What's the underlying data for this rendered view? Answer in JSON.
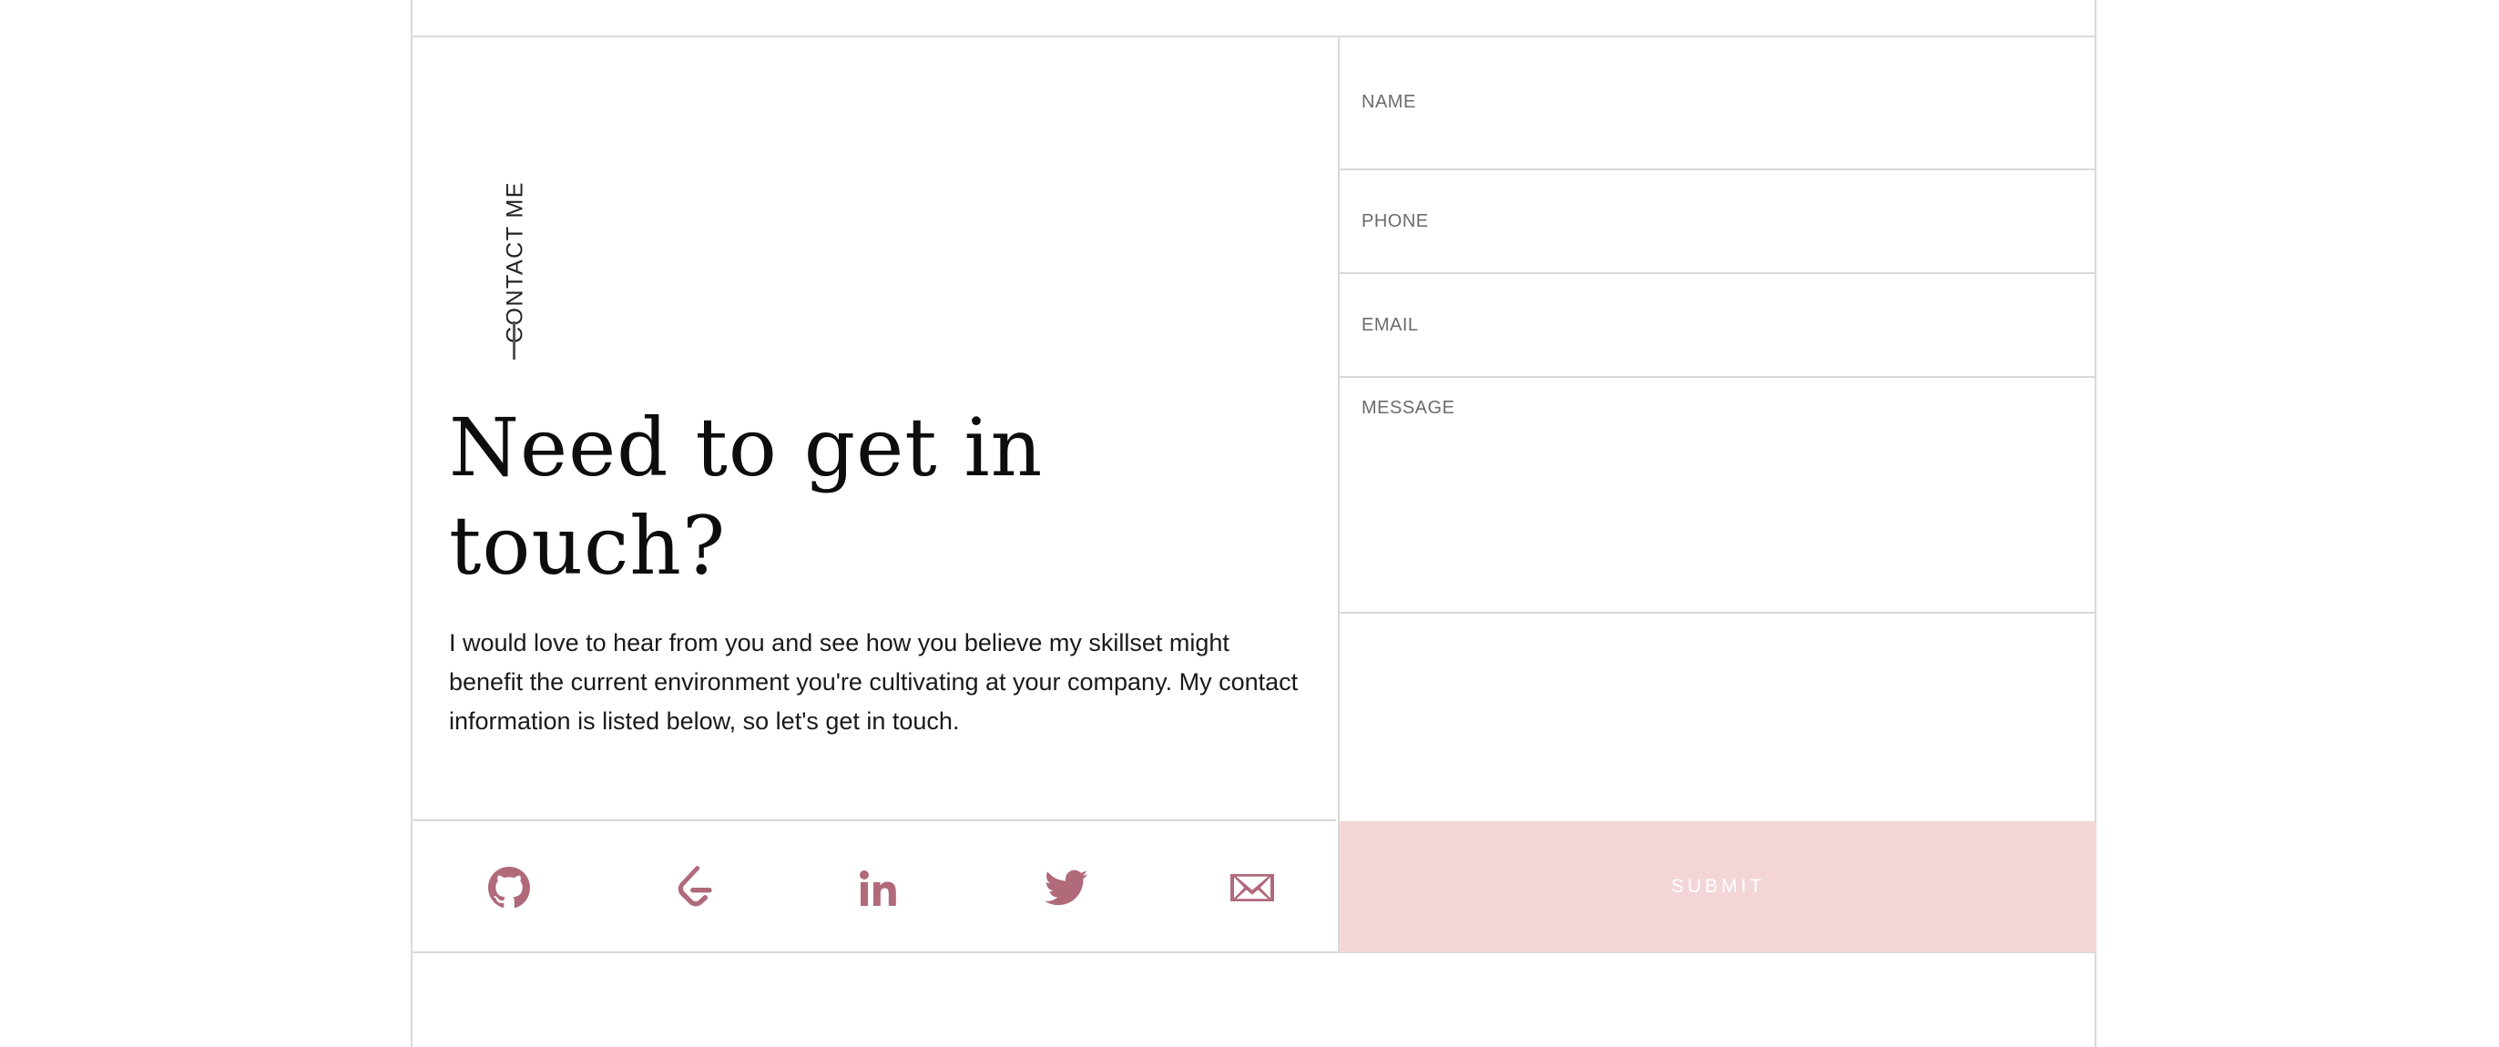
{
  "contact": {
    "label": "CONTACT ME",
    "headline": "Need to get in touch?",
    "body": "I would love to hear from you and see how you believe my skillset might benefit the current environment you're cultivating at your company. My contact information is listed below, so let's get in touch."
  },
  "social": [
    {
      "name": "github",
      "icon": "github-icon"
    },
    {
      "name": "leetcode",
      "icon": "leetcode-icon"
    },
    {
      "name": "linkedin",
      "icon": "linkedin-icon"
    },
    {
      "name": "twitter",
      "icon": "twitter-icon"
    },
    {
      "name": "email",
      "icon": "mail-icon"
    }
  ],
  "form": {
    "name_placeholder": "NAME",
    "phone_placeholder": "PHONE",
    "email_placeholder": "EMAIL",
    "message_placeholder": "MESSAGE",
    "submit_label": "SUBMIT"
  },
  "colors": {
    "accent": "#b06a7a",
    "submit_bg": "#f3d5d8",
    "border": "#d9d9d9"
  }
}
